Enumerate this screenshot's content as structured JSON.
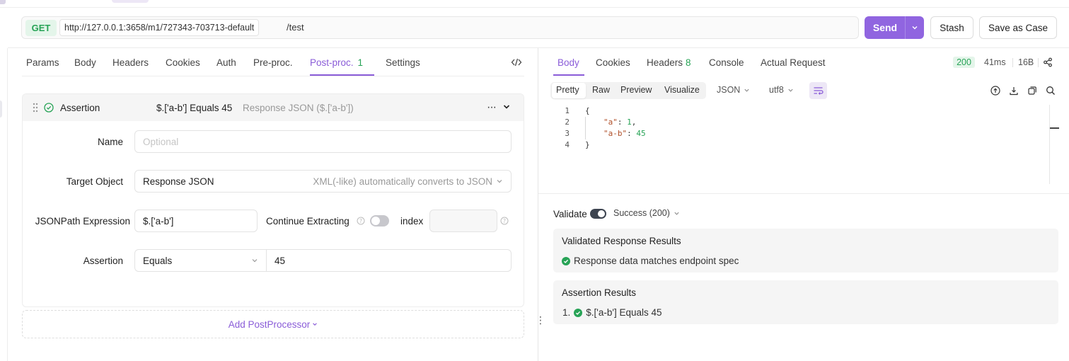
{
  "request": {
    "method": "GET",
    "base_url": "http://127.0.0.1:3658/m1/727343-703713-default",
    "path": "/test",
    "send_label": "Send",
    "stash_label": "Stash",
    "save_case_label": "Save as Case"
  },
  "left_tabs": [
    {
      "label": "Params"
    },
    {
      "label": "Body"
    },
    {
      "label": "Headers"
    },
    {
      "label": "Cookies"
    },
    {
      "label": "Auth"
    },
    {
      "label": "Pre-proc."
    },
    {
      "label": "Post-proc.",
      "count": "1",
      "active": true
    },
    {
      "label": "Settings"
    }
  ],
  "assertion": {
    "title": "Assertion",
    "summary": "$.['a-b'] Equals 45",
    "summary_sub": "Response JSON ($.['a-b'])",
    "name_label": "Name",
    "name_placeholder": "Optional",
    "target_label": "Target Object",
    "target_value": "Response JSON",
    "target_hint": "XML(-like) automatically converts to JSON",
    "jsonpath_label": "JSONPath Expression",
    "jsonpath_value": "$.['a-b']",
    "continue_label": "Continue Extracting",
    "continue_enabled": false,
    "index_label": "index",
    "assertion_label": "Assertion",
    "operator": "Equals",
    "expected": "45"
  },
  "add_postprocessor": "Add PostProcessor",
  "response_tabs": [
    {
      "label": "Body",
      "active": true
    },
    {
      "label": "Cookies"
    },
    {
      "label": "Headers",
      "count": "8"
    },
    {
      "label": "Console"
    },
    {
      "label": "Actual Request"
    }
  ],
  "response_meta": {
    "status": "200",
    "time": "41ms",
    "size": "16B"
  },
  "view_modes": [
    "Pretty",
    "Raw",
    "Preview",
    "Visualize"
  ],
  "format_select": "JSON",
  "encoding_select": "utf8",
  "code_lines": [
    {
      "n": "1",
      "text": "{"
    },
    {
      "n": "2",
      "key": "\"a\"",
      "value": "1",
      "trail": ","
    },
    {
      "n": "3",
      "key": "\"a-b\"",
      "value": "45",
      "trail": ""
    },
    {
      "n": "4",
      "text": "}"
    }
  ],
  "validate": {
    "label": "Validate",
    "enabled": true,
    "status_select": "Success (200)"
  },
  "validated_results": {
    "title": "Validated Response Results",
    "message": "Response data matches endpoint spec"
  },
  "assertion_results": {
    "title": "Assertion Results",
    "items": [
      {
        "index": "1.",
        "text": "$.['a-b'] Equals 45"
      }
    ]
  },
  "colors": {
    "accent": "#8a5cd8",
    "send": "#9065e0",
    "success": "#27a356"
  }
}
